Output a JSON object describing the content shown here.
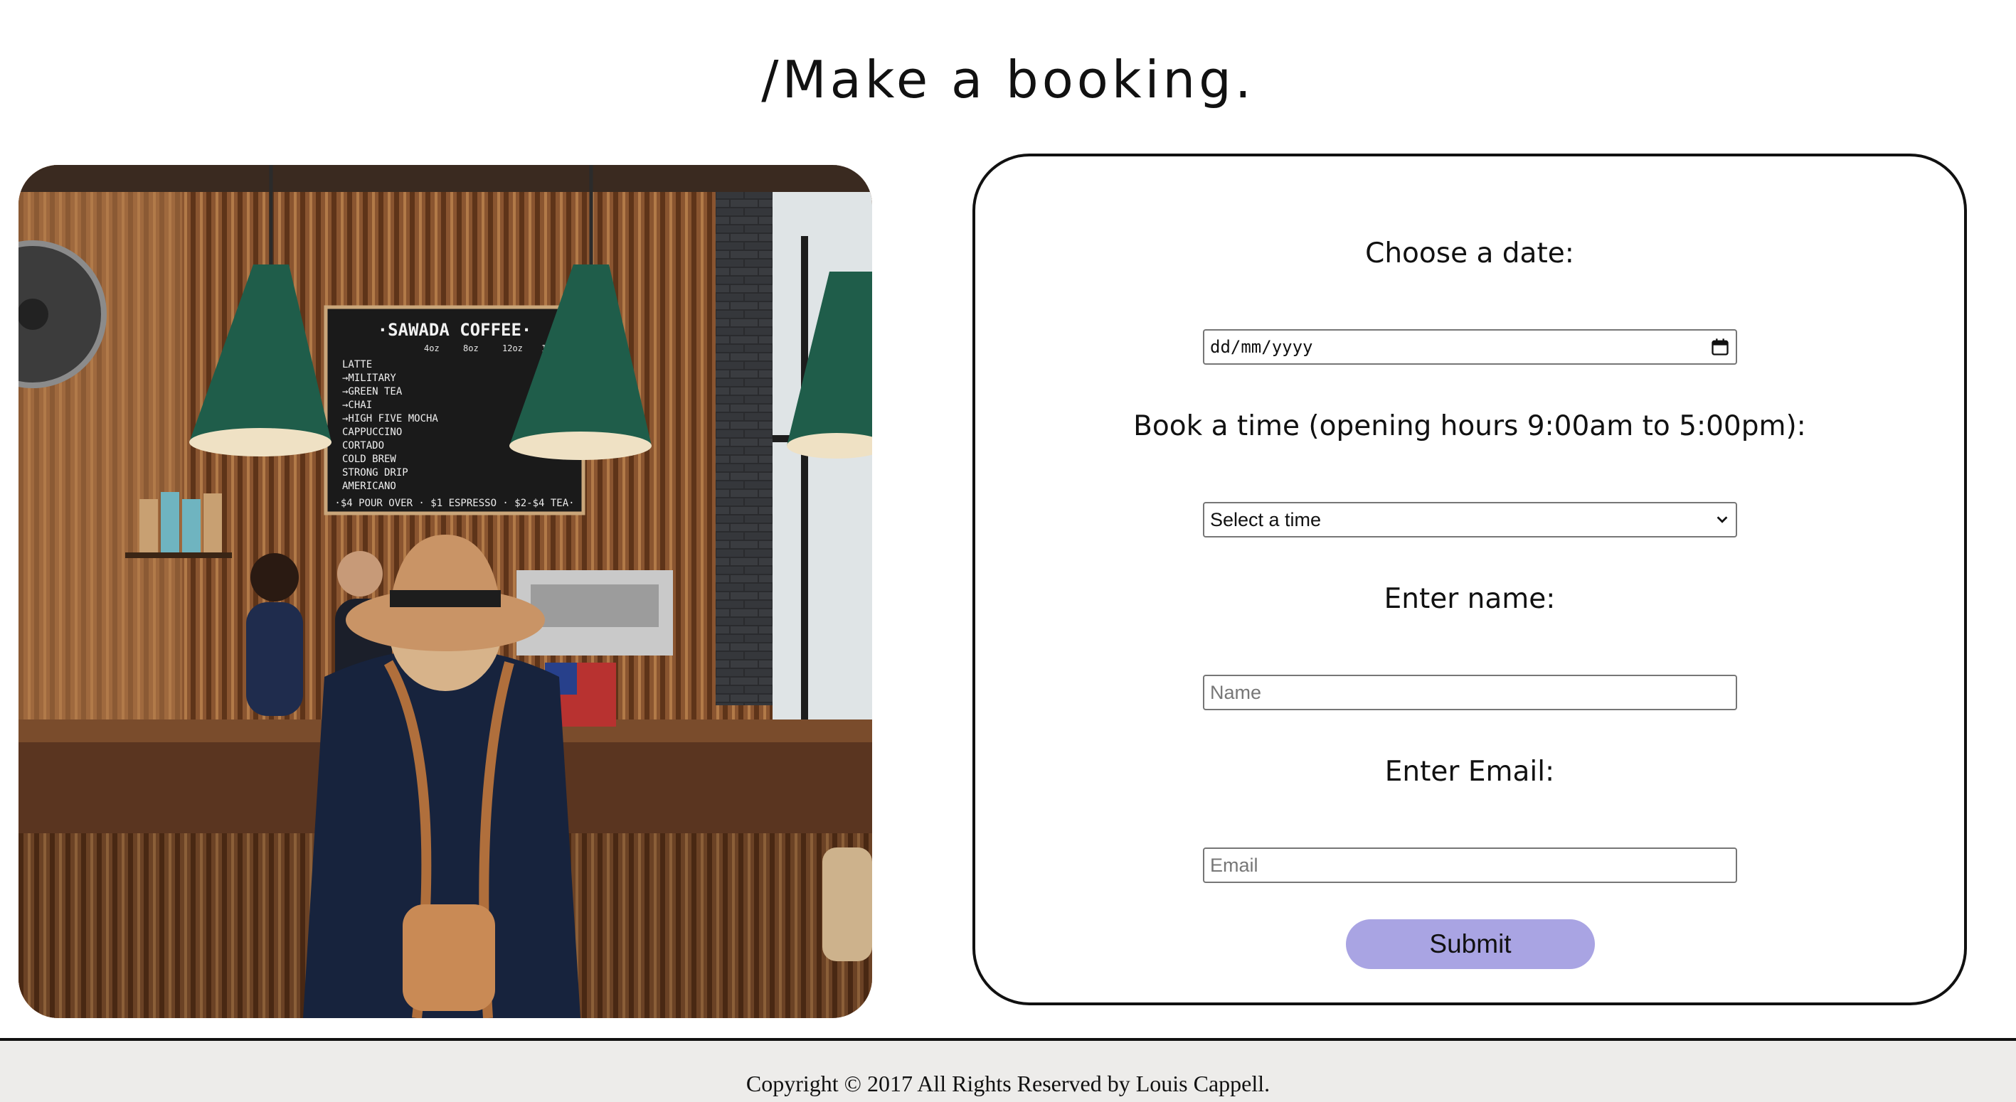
{
  "page": {
    "title": "/Make a booking."
  },
  "photo": {
    "menu_board": {
      "heading": "·SAWADA   COFFEE·",
      "sizes": [
        "4oz",
        "8oz",
        "12oz",
        "16oz"
      ],
      "items": [
        "LATTE",
        "→MILITARY",
        "→GREEN TEA",
        "→CHAI",
        "→HIGH FIVE MOCHA",
        "CAPPUCCINO",
        "CORTADO",
        "COLD BREW",
        "STRONG DRIP",
        "AMERICANO"
      ],
      "footer": "·$4 POUR OVER · $1 ESPRESSO · $2-$4 TEA·"
    }
  },
  "form": {
    "date_label": "Choose a date:",
    "date_placeholder": "dd/mm/yyyy",
    "time_label": "Book a time (opening hours 9:00am to 5:00pm):",
    "time_selected": "Select a time",
    "name_label": "Enter name:",
    "name_placeholder": "Name",
    "email_label": "Enter Email:",
    "email_placeholder": "Email",
    "submit_label": "Submit",
    "submit_color": "#a9a4e3"
  },
  "footer": {
    "text": "Copyright © 2017 All Rights Reserved by Louis Cappell."
  }
}
